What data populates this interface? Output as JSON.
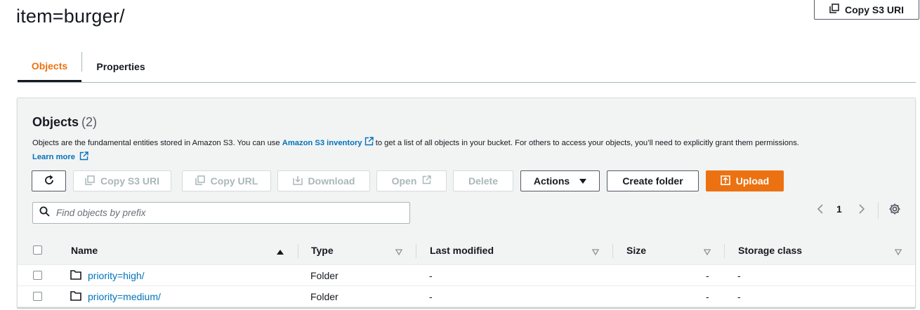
{
  "header": {
    "title": "item=burger/",
    "copy_s3_uri": "Copy S3 URI"
  },
  "tabs": [
    {
      "label": "Objects",
      "active": true
    },
    {
      "label": "Properties",
      "active": false
    }
  ],
  "objects_panel": {
    "heading": "Objects",
    "count": "(2)",
    "description_before": "Objects are the fundamental entities stored in Amazon S3. You can use ",
    "inventory_link": "Amazon S3 inventory",
    "description_after": " to get a list of all objects in your bucket. For others to access your objects, you’ll need to explicitly grant them permissions.",
    "learn_more": "Learn more"
  },
  "toolbar": {
    "refresh_icon": "refresh-icon",
    "copy_s3_uri": "Copy S3 URI",
    "copy_url": "Copy URL",
    "download": "Download",
    "open": "Open",
    "delete": "Delete",
    "actions": "Actions",
    "create_folder": "Create folder",
    "upload": "Upload"
  },
  "search": {
    "placeholder": "Find objects by prefix",
    "value": ""
  },
  "pagination": {
    "current_page": "1"
  },
  "table": {
    "columns": [
      "Name",
      "Type",
      "Last modified",
      "Size",
      "Storage class"
    ],
    "rows": [
      {
        "name": "priority=high/",
        "type": "Folder",
        "last_modified": "-",
        "size": "-",
        "storage_class": "-"
      },
      {
        "name": "priority=medium/",
        "type": "Folder",
        "last_modified": "-",
        "size": "-",
        "storage_class": "-"
      }
    ]
  },
  "colors": {
    "accent": "#ec7211",
    "link": "#0073bb",
    "text": "#16191f",
    "header_bg": "#f2f3f3"
  }
}
